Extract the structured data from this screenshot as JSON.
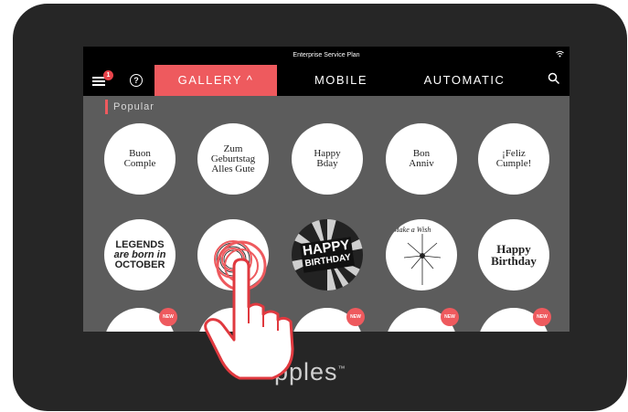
{
  "status_bar": {
    "plan": "Enterprise Service Plan",
    "wifi_icon": "wifi-icon"
  },
  "nav": {
    "menu_badge": "1",
    "help_label": "?",
    "tabs": [
      {
        "label": "GALLERY ^",
        "active": true
      },
      {
        "label": "MOBILE",
        "active": false
      },
      {
        "label": "AUTOMATIC",
        "active": false
      }
    ],
    "search_icon": "search-icon"
  },
  "section": {
    "title": "Popular"
  },
  "tiles": [
    {
      "line1": "Buon",
      "line2": "Comple"
    },
    {
      "line1": "Zum",
      "line2": "Geburtstag",
      "line3": "Alles Gute"
    },
    {
      "line1": "Happy",
      "line2": "Bday"
    },
    {
      "line1": "Bon",
      "line2": "Anniv"
    },
    {
      "line1": "¡Feliz",
      "line2": "Cumple!"
    },
    {
      "line1": "LEGENDS",
      "line2": "are born in",
      "line3": "OCTOBER"
    },
    {
      "line1": "",
      "line2": ""
    },
    {
      "line1": "HAPPY",
      "line2": "BIRTHDAY"
    },
    {
      "line1": "Make a",
      "line2": "Wish"
    },
    {
      "line1": "Happy",
      "line2": "Birthday"
    }
  ],
  "new_badge": "NEW",
  "brand": {
    "name": "pples",
    "tm": "™"
  },
  "colors": {
    "accent": "#ee5a5e",
    "screen_bg": "#5c5c5c",
    "device": "#262626"
  }
}
